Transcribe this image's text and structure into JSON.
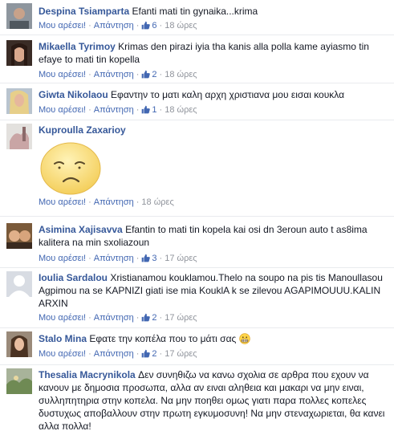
{
  "colors": {
    "name_link": "#365899",
    "action_link": "#4267b2",
    "meta_gray": "#90949c",
    "separator": "#e9ebee"
  },
  "comments": [
    {
      "name": "Despina Tsiamparta",
      "text": "Efanti mati tin gynaika...krima",
      "like_label": "Μου αρέσει!",
      "reply_label": "Απάντηση",
      "likes": "6",
      "time": "18 ώρες"
    },
    {
      "name": "Mikaella Tyrimoy",
      "text": "Krimas den pirazi iyia tha kanis alla polla kame ayiasmo tin efaye to mati tin kopella",
      "like_label": "Μου αρέσει!",
      "reply_label": "Απάντηση",
      "likes": "2",
      "time": "18 ώρες"
    },
    {
      "name": "Giwta Nikolaou",
      "text": "Εφαντην το ματι καλη αρχη χριστιανα μου εισαι κουκλα",
      "like_label": "Μου αρέσει!",
      "reply_label": "Απάντηση",
      "likes": "1",
      "time": "18 ώρες"
    },
    {
      "name": "Kuproulla Zaxarioy",
      "text": "",
      "like_label": "Μου αρέσει!",
      "reply_label": "Απάντηση",
      "likes": "",
      "time": "18 ώρες",
      "sticker": "worried-face-sticker"
    },
    {
      "name": "Asimina Xajisavva",
      "text": "Efantin to mati tin kopela kai osi dn 3eroun auto t as8ima kalitera na min sxoliazoun",
      "like_label": "Μου αρέσει!",
      "reply_label": "Απάντηση",
      "likes": "3",
      "time": "17 ώρες"
    },
    {
      "name": "Ioulia Sardalou",
      "text": "Xristianamou kouklamou.Thelo na soupo na pis tis Manoullasou Agpimou na se KAPNIZI giati ise mia KouklA k se zilevou AGAPIMOUUU.KALIN ARXIN",
      "like_label": "Μου αρέσει!",
      "reply_label": "Απάντηση",
      "likes": "2",
      "time": "17 ώρες"
    },
    {
      "name": "Stalo Mina",
      "text": "Εφατε την κοπέλα που το μάτι σας",
      "emoji": "grimacing-emoji",
      "like_label": "Μου αρέσει!",
      "reply_label": "Απάντηση",
      "likes": "2",
      "time": "17 ώρες"
    },
    {
      "name": "Thesalia Macrynikola",
      "text": "Δεν συνηθιζω να κανω σχολια σε αρθρα που εχουν να κανουν με δημοσια προσωπα, αλλα αν ειναι αληθεια και μακαρι να μην ειναι, συλληπητηρια στην κοπελα. Να μην ποηθει ομως γιατι παρα πολλες κοπελες δυστυχως αποβαλλουν στην πρωτη εγκυμοσυνη! Να μην στεναχωριεται, θα κανει αλλα πολλα!"
    }
  ]
}
